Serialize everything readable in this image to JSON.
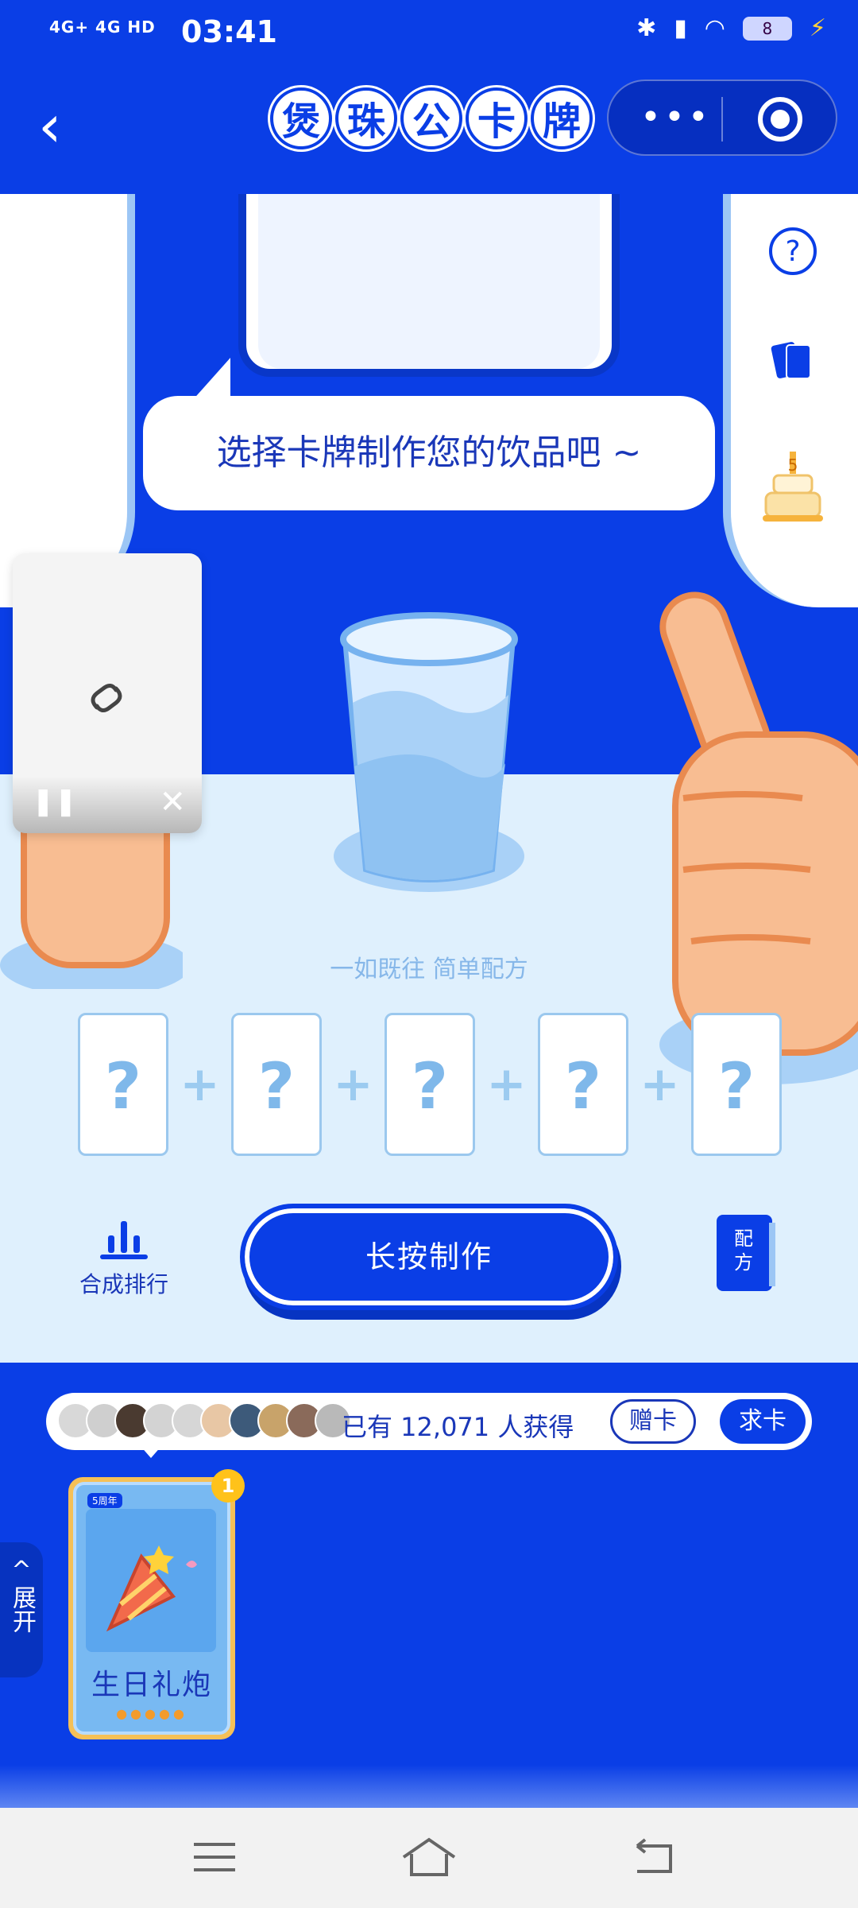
{
  "status_bar": {
    "time": "03:41",
    "signal_left": "4G+ 4G HD",
    "battery": "8"
  },
  "nav": {
    "title_chars": [
      "煲",
      "珠",
      "公",
      "卡",
      "牌"
    ],
    "more_label": "•••"
  },
  "scene": {
    "speech": "选择卡牌制作您的饮品吧 ~",
    "recipe_label": "一如既往 简单配方",
    "slots": [
      "?",
      "?",
      "?",
      "?",
      "?"
    ],
    "plus": "+"
  },
  "side_menu": {
    "rules": "活动规则",
    "history": "历史卡牌",
    "anniv_line1": "5周年",
    "anniv_line2": "活动规则"
  },
  "actions": {
    "rank_label": "合成排行",
    "make_label": "长按制作",
    "recipe_book_label": "配方"
  },
  "stats": {
    "text": "已有 12,071 人获得",
    "gift_label": "赠卡",
    "ask_label": "求卡"
  },
  "card": {
    "tag": "5周年",
    "name": "生日礼炮",
    "count": "1",
    "dots": "●●●●●"
  },
  "expand": {
    "arrow": "^",
    "label": "展开"
  },
  "colors": {
    "brand_blue": "#0a3ee6",
    "light_bg": "#dff0fd",
    "card_gold": "#f5c057",
    "badge_yellow": "#ffc21a"
  }
}
